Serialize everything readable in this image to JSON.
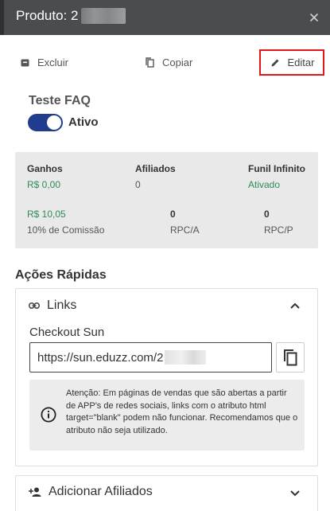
{
  "header": {
    "title": "Produto: 2",
    "close_icon": "close-icon"
  },
  "actions": {
    "delete_label": "Excluir",
    "copy_label": "Copiar",
    "edit_label": "Editar",
    "highlight_color": "#e0181b"
  },
  "product": {
    "name": "Teste FAQ",
    "status_label": "Ativo",
    "toggle_color": "#1f3c8f",
    "active": true
  },
  "stats": {
    "earnings_label": "Ganhos",
    "earnings_value": "R$ 0,00",
    "affiliates_label": "Afiliados",
    "affiliates_value": "0",
    "funnel_label": "Funil Infinito",
    "funnel_value": "Ativado",
    "commission_value": "R$ 10,05",
    "commission_label": "10% de Comissão",
    "rpca_value": "0",
    "rpca_label": "RPC/A",
    "rpcp_value": "0",
    "rpcp_label": "RPC/P",
    "positive_color": "#2e8b57"
  },
  "quick_actions": {
    "title": "Ações Rápidas",
    "links_panel": {
      "title": "Links",
      "expanded": true,
      "checkout_label": "Checkout Sun",
      "checkout_url": "https://sun.eduzz.com/2",
      "warning": "Atenção: Em páginas de vendas que são abertas a partir de APP's de redes sociais, links com o atributo html target=\"blank\" podem não funcionar. Recomendamos que o atributo não seja utilizado."
    },
    "affiliates_panel": {
      "title": "Adicionar Afiliados",
      "expanded": false
    }
  }
}
